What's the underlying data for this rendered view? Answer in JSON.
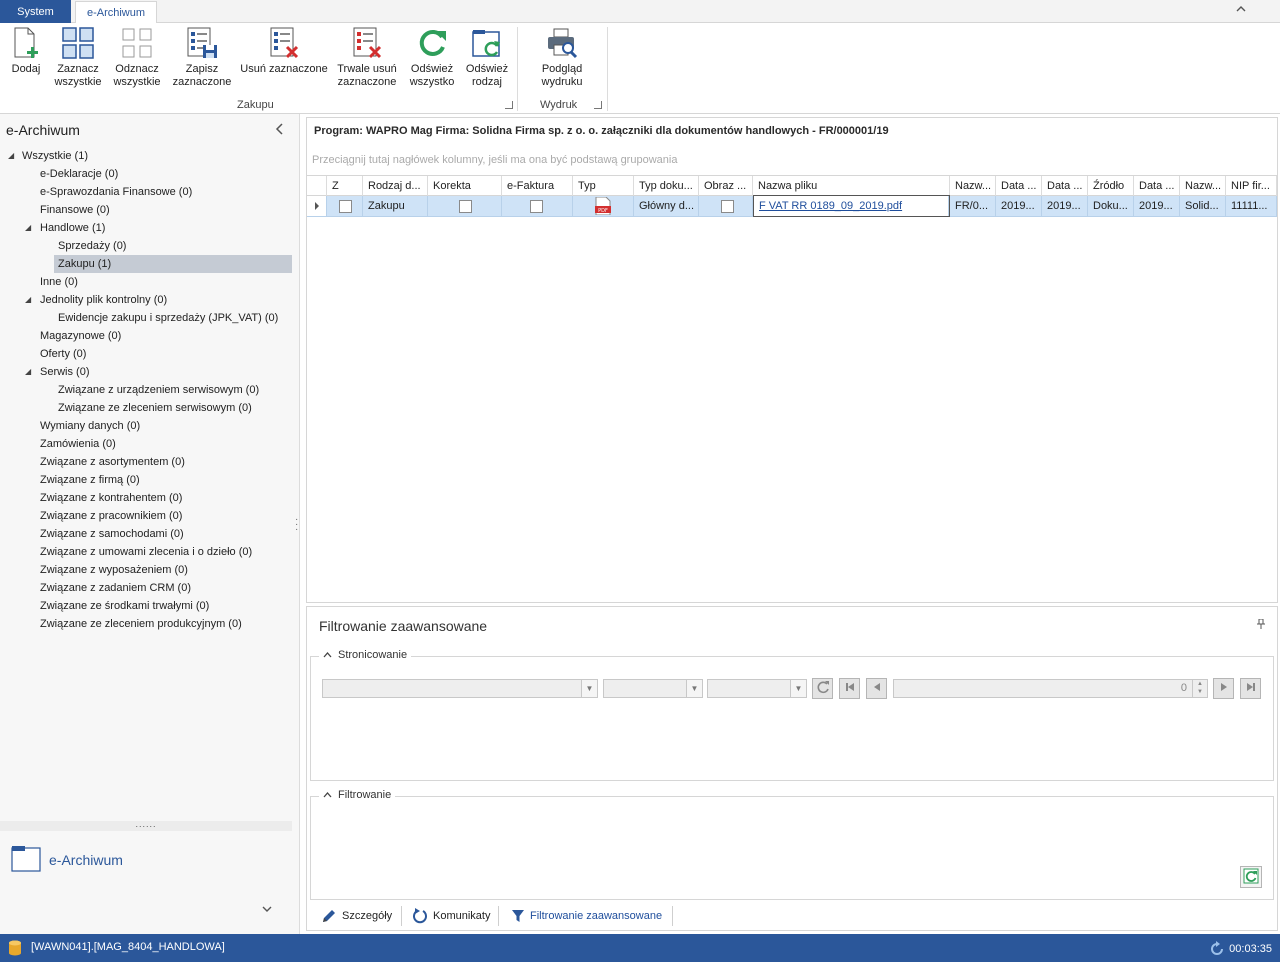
{
  "tabs": [
    {
      "label": "System"
    },
    {
      "label": "e-Archiwum"
    }
  ],
  "ribbon": {
    "buttons": [
      {
        "label": "Dodaj",
        "icon": "add-document-icon"
      },
      {
        "label": "Zaznacz\nwszystkie",
        "icon": "select-all-icon"
      },
      {
        "label": "Odznacz\nwszystkie",
        "icon": "deselect-all-icon"
      },
      {
        "label": "Zapisz\nzaznaczone",
        "icon": "save-selected-icon"
      },
      {
        "label": "Usuń zaznaczone",
        "icon": "delete-selected-icon"
      },
      {
        "label": "Trwale usuń\nzaznaczone",
        "icon": "permanent-delete-icon"
      },
      {
        "label": "Odśwież\nwszystko",
        "icon": "refresh-all-icon"
      },
      {
        "label": "Odśwież\nrodzaj",
        "icon": "refresh-type-icon"
      },
      {
        "label": "Podgląd\nwydruku",
        "icon": "print-preview-icon"
      }
    ],
    "groups": [
      {
        "label": "Zakupu"
      },
      {
        "label": "Wydruk"
      }
    ]
  },
  "nav": {
    "title": "e-Archiwum",
    "tree": [
      {
        "label": "Wszystkie (1)",
        "level": 0,
        "expanded": true
      },
      {
        "label": "e-Deklaracje (0)",
        "level": 1
      },
      {
        "label": "e-Sprawozdania Finansowe (0)",
        "level": 1
      },
      {
        "label": "Finansowe (0)",
        "level": 1
      },
      {
        "label": "Handlowe (1)",
        "level": 1,
        "expanded": true
      },
      {
        "label": "Sprzedaży (0)",
        "level": 2
      },
      {
        "label": "Zakupu (1)",
        "level": 2,
        "selected": true
      },
      {
        "label": "Inne (0)",
        "level": 1
      },
      {
        "label": "Jednolity plik kontrolny (0)",
        "level": 1,
        "expanded": true
      },
      {
        "label": "Ewidencje zakupu i sprzedaży (JPK_VAT) (0)",
        "level": 2
      },
      {
        "label": "Magazynowe (0)",
        "level": 1
      },
      {
        "label": "Oferty (0)",
        "level": 1
      },
      {
        "label": "Serwis (0)",
        "level": 1,
        "expanded": true
      },
      {
        "label": "Związane z urządzeniem serwisowym (0)",
        "level": 2
      },
      {
        "label": "Związane ze zleceniem serwisowym (0)",
        "level": 2
      },
      {
        "label": "Wymiany danych (0)",
        "level": 1
      },
      {
        "label": "Zamówienia (0)",
        "level": 1
      },
      {
        "label": "Związane z asortymentem (0)",
        "level": 1
      },
      {
        "label": "Związane z firmą (0)",
        "level": 1
      },
      {
        "label": "Związane z kontrahentem (0)",
        "level": 1
      },
      {
        "label": "Związane z pracownikiem (0)",
        "level": 1
      },
      {
        "label": "Związane z samochodami (0)",
        "level": 1
      },
      {
        "label": "Związane z umowami zlecenia i o dzieło (0)",
        "level": 1
      },
      {
        "label": "Związane z wyposażeniem (0)",
        "level": 1
      },
      {
        "label": "Związane z zadaniem CRM (0)",
        "level": 1
      },
      {
        "label": "Związane ze środkami trwałymi (0)",
        "level": 1
      },
      {
        "label": "Związane ze zleceniem produkcyjnym (0)",
        "level": 1
      }
    ],
    "splitter": "......",
    "module_label": "e-Archiwum"
  },
  "main": {
    "infobar": "Program: WAPRO Mag    Firma: Solidna Firma sp. z o. o.   załączniki dla dokumentów handlowych - FR/000001/19",
    "group_prompt": "Przeciągnij tutaj nagłówek kolumny, jeśli ma ona być podstawą grupowania",
    "columns": [
      "Z",
      "Rodzaj d...",
      "Korekta",
      "e-Faktura",
      "Typ",
      "Typ doku...",
      "Obraz ...",
      "Nazwa pliku",
      "Nazw...",
      "Data ...",
      "Data ...",
      "Źródło",
      "Data ...",
      "Nazw...",
      "NIP fir..."
    ],
    "rows": [
      {
        "z": false,
        "rodzaj": "Zakupu",
        "korekta": false,
        "efaktura": false,
        "typ_icon": "pdf-icon",
        "typ_dok": "Główny d...",
        "obraz": false,
        "nazwa_pliku": "F VAT RR 0189_09_2019.pdf",
        "nazwa1": "FR/0...",
        "data1": "2019...",
        "data2": "2019...",
        "zrodlo": "Doku...",
        "data3": "2019...",
        "nazwa2": "Solid...",
        "nip": "11111..."
      }
    ]
  },
  "filter": {
    "title": "Filtrowanie zaawansowane",
    "sections": [
      {
        "label": "Stronicowanie"
      },
      {
        "label": "Filtrowanie"
      }
    ],
    "page_value": "0"
  },
  "bottom_tabs": [
    {
      "label": "Szczegóły",
      "icon": "pencil-icon"
    },
    {
      "label": "Komunikaty",
      "icon": "refresh-circle-icon"
    },
    {
      "label": "Filtrowanie zaawansowane",
      "icon": "funnel-icon"
    }
  ],
  "status": {
    "db": "[WAWN041].[MAG_8404_HANDLOWA]",
    "time": "00:03:35"
  },
  "colors": {
    "accent": "#2b579a",
    "selection": "#cfe3f7",
    "green": "#2e9e5a",
    "red": "#d32f2f"
  }
}
